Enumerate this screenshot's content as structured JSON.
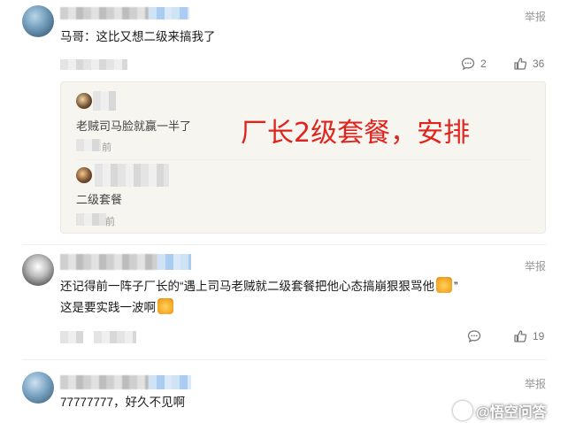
{
  "comments": [
    {
      "text": "马哥：这比又想二级来搞我了",
      "report": "举报",
      "reply_count": "2",
      "like_count": "36",
      "replies": [
        {
          "text": "老贼司马脸就赢一半了",
          "time": "前"
        },
        {
          "text": "二级套餐",
          "time": "前"
        }
      ]
    },
    {
      "text_line1_a": "还记得前一阵子厂长的“遇上司马老贼就二级套餐把他心态搞崩狠狠骂他",
      "text_line1_b": "”",
      "text_line2": "这是要实践一波啊",
      "report": "举报",
      "like_count": "19"
    },
    {
      "text": "77777777，好久不见啊",
      "report": "举报"
    }
  ],
  "overlay_caption": "厂长2级套餐，安排",
  "watermark": {
    "text": "@悟空问答"
  },
  "colors": {
    "overlay": "#e0231c",
    "reply_bg": "#f7f5f0"
  }
}
